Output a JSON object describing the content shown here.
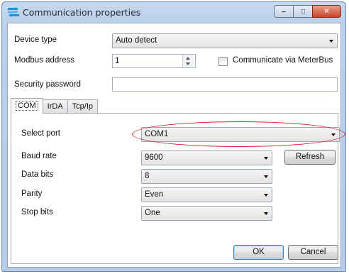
{
  "window": {
    "title": "Communication properties",
    "icon": "network-transfer-icon",
    "controls": {
      "minimize": "–",
      "maximize": "□",
      "close": "✕"
    }
  },
  "form": {
    "device_type": {
      "label": "Device type",
      "value": "Auto detect"
    },
    "modbus_address": {
      "label": "Modbus address",
      "value": "1"
    },
    "meterbus": {
      "label": "Communicate via MeterBus",
      "checked": false
    },
    "security_password": {
      "label": "Security password",
      "value": ""
    }
  },
  "tabs": [
    {
      "label": "COM",
      "active": true
    },
    {
      "label": "IrDA",
      "active": false
    },
    {
      "label": "Tcp/Ip",
      "active": false
    }
  ],
  "com_tab": {
    "select_port": {
      "label": "Select port",
      "value": "COM1"
    },
    "baud_rate": {
      "label": "Baud rate",
      "value": "9600"
    },
    "refresh_label": "Refresh",
    "data_bits": {
      "label": "Data bits",
      "value": "8"
    },
    "parity": {
      "label": "Parity",
      "value": "Even"
    },
    "stop_bits": {
      "label": "Stop bits",
      "value": "One"
    }
  },
  "footer": {
    "ok_label": "OK",
    "cancel_label": "Cancel"
  },
  "annotation": {
    "color": "#d42020"
  }
}
